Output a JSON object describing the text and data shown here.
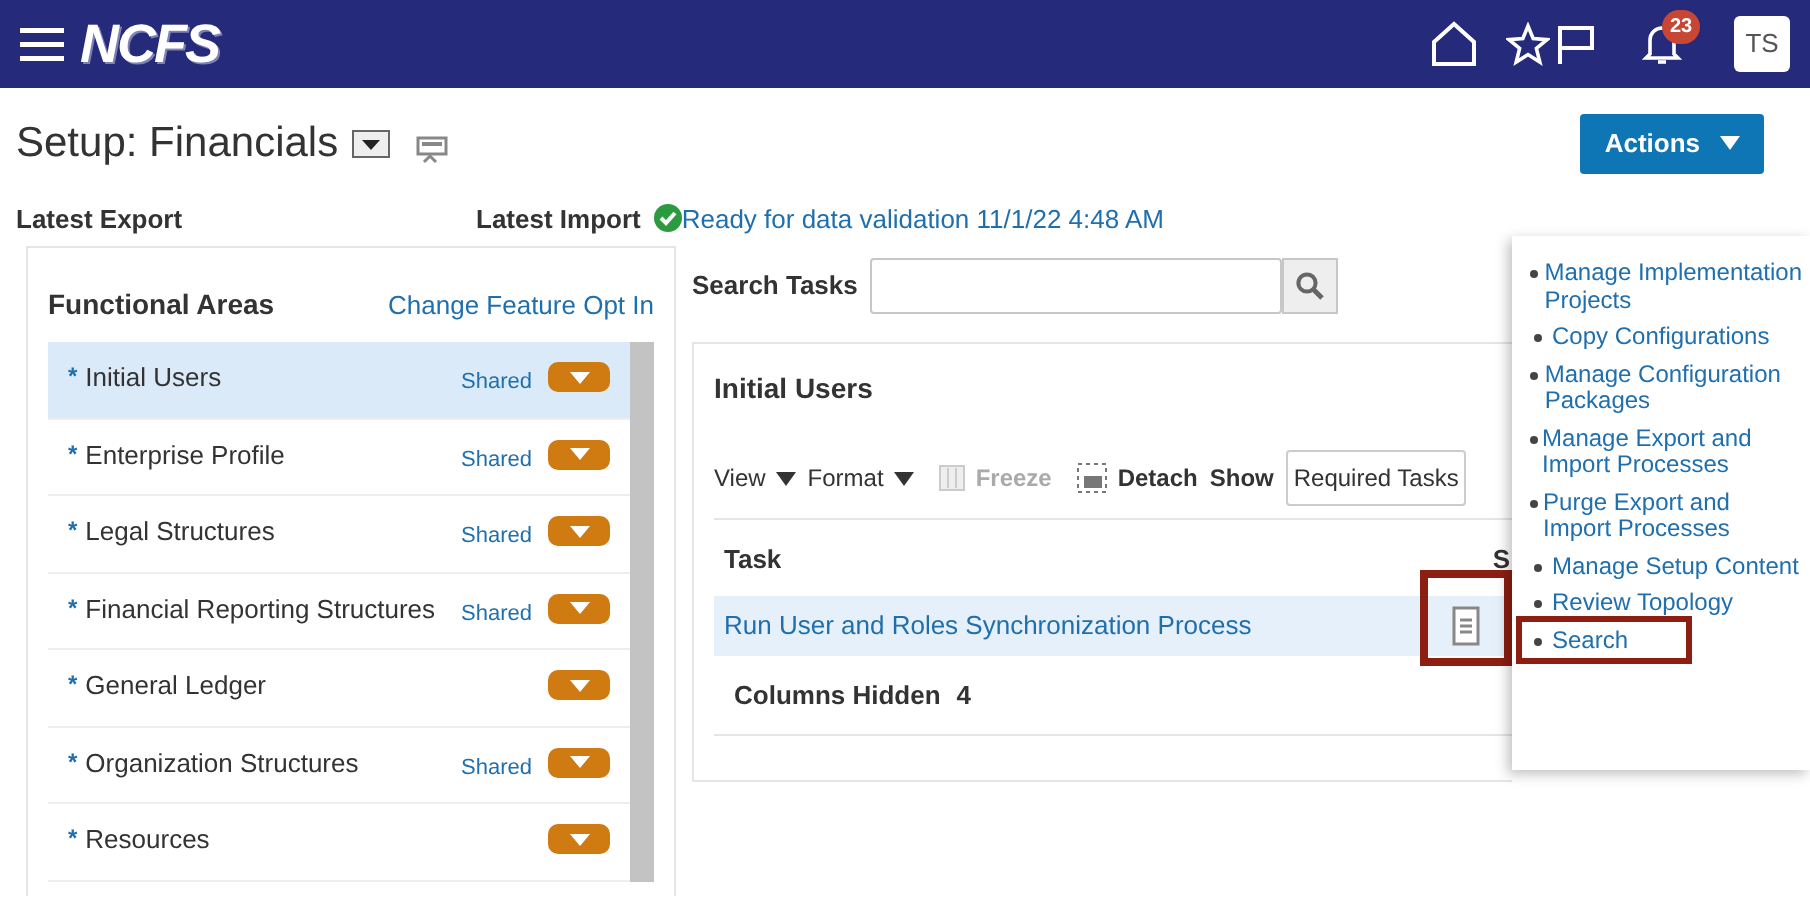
{
  "header": {
    "logo_text": "NCFS",
    "notification_count": "23",
    "user_initials": "TS"
  },
  "page": {
    "title": "Setup: Financials",
    "actions_button": "Actions"
  },
  "status": {
    "latest_export_label": "Latest Export",
    "latest_import_label": "Latest Import",
    "import_status": "Ready for data validation 11/1/22 4:48 AM"
  },
  "functional_areas": {
    "title": "Functional Areas",
    "link": "Change Feature Opt In",
    "items": [
      {
        "required_mark": "*",
        "label": "Initial Users",
        "tag": "Shared",
        "selected": true
      },
      {
        "required_mark": "*",
        "label": "Enterprise Profile",
        "tag": "Shared",
        "selected": false
      },
      {
        "required_mark": "*",
        "label": "Legal Structures",
        "tag": "Shared",
        "selected": false
      },
      {
        "required_mark": "*",
        "label": "Financial Reporting Structures",
        "tag": "Shared",
        "selected": false
      },
      {
        "required_mark": "*",
        "label": "General Ledger",
        "selected": false
      },
      {
        "required_mark": "*",
        "label": "Organization Structures",
        "tag": "Shared",
        "selected": false
      },
      {
        "required_mark": "*",
        "label": "Resources",
        "selected": false
      }
    ]
  },
  "search_tasks": {
    "label": "Search Tasks"
  },
  "task_panel": {
    "title": "Initial Users",
    "toolbar": [
      {
        "label": "View",
        "kind": "menu",
        "disabled": false
      },
      {
        "label": "Format",
        "kind": "menu",
        "disabled": false
      },
      {
        "label": "Freeze",
        "kind": "icon-button",
        "disabled": true
      },
      {
        "label": "Detach",
        "kind": "icon-button",
        "disabled": false
      }
    ],
    "show_label": "Show",
    "show_value": "Required Tasks",
    "columns": [
      "Task",
      "S"
    ],
    "rows": [
      {
        "task": "Run User and Roles Synchronization Process",
        "selected": true,
        "highlighted": true
      }
    ],
    "columns_hidden_label": "Columns Hidden",
    "columns_hidden_count": "4"
  },
  "actions_menu": {
    "items": [
      {
        "label": "Manage Implementation Projects",
        "highlighted": false
      },
      {
        "label": "Copy Configurations",
        "highlighted": false
      },
      {
        "label": "Manage Configuration Packages",
        "highlighted": false
      },
      {
        "label": "Manage Export and Import Processes",
        "highlighted": false
      },
      {
        "label": "Purge Export and Import Processes",
        "highlighted": false
      },
      {
        "label": "Manage Setup Content",
        "highlighted": false
      },
      {
        "label": "Review Topology",
        "highlighted": false
      },
      {
        "label": "Search",
        "highlighted": true
      }
    ]
  }
}
